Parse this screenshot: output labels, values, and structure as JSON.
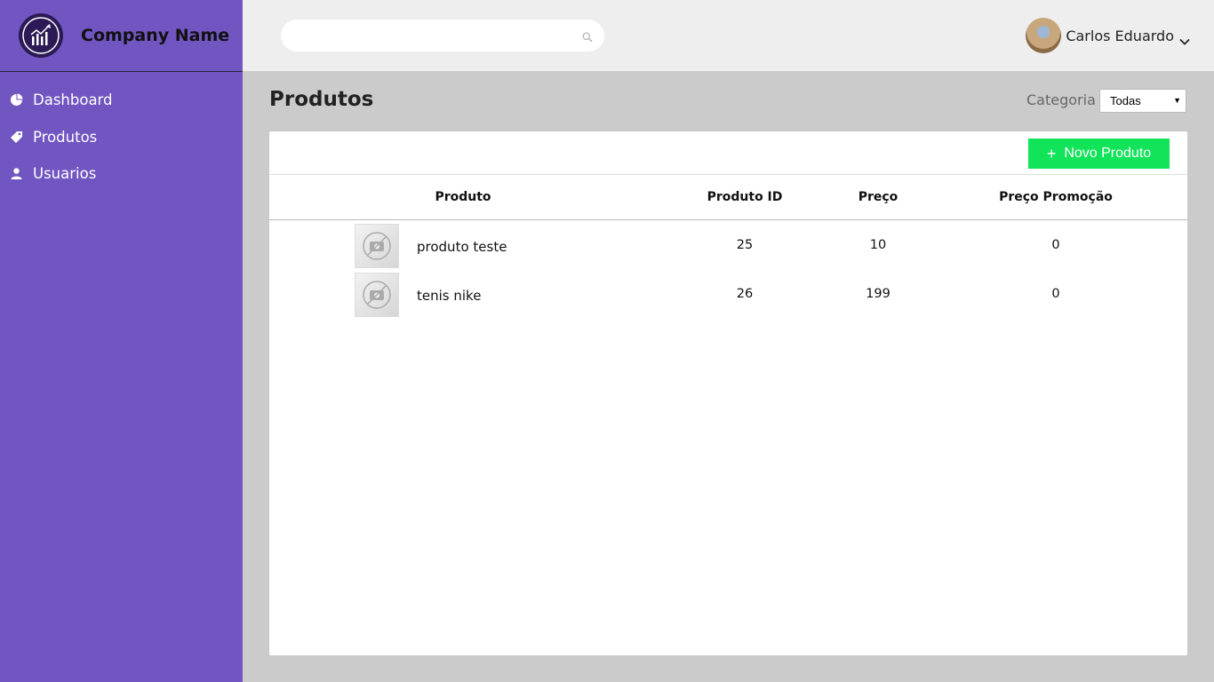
{
  "brand": {
    "name": "Company Name",
    "logo_icon": "bar-chart-logo-icon"
  },
  "sidebar": {
    "items": [
      {
        "label": "Dashboard",
        "icon": "pie-chart-icon"
      },
      {
        "label": "Produtos",
        "icon": "tag-icon"
      },
      {
        "label": "Usuarios",
        "icon": "user-icon"
      }
    ]
  },
  "header": {
    "search": {
      "placeholder": "",
      "value": ""
    },
    "user": {
      "name": "Carlos Eduardo"
    }
  },
  "page": {
    "title": "Produtos",
    "category_label": "Categoria",
    "category_selected": "Todas"
  },
  "toolbar": {
    "new_product_label": "Novo Produto"
  },
  "table": {
    "columns": [
      "Produto",
      "Produto ID",
      "Preço",
      "Preço Promoção"
    ],
    "rows": [
      {
        "produto": "produto teste",
        "id": "25",
        "preco": "10",
        "promo": "0"
      },
      {
        "produto": "tenis nike",
        "id": "26",
        "preco": "199",
        "promo": "0"
      }
    ]
  },
  "colors": {
    "sidebar": "#7155c1",
    "accent_button": "#12e459",
    "background": "#cbcbcb",
    "topbar": "#eeeeee"
  }
}
